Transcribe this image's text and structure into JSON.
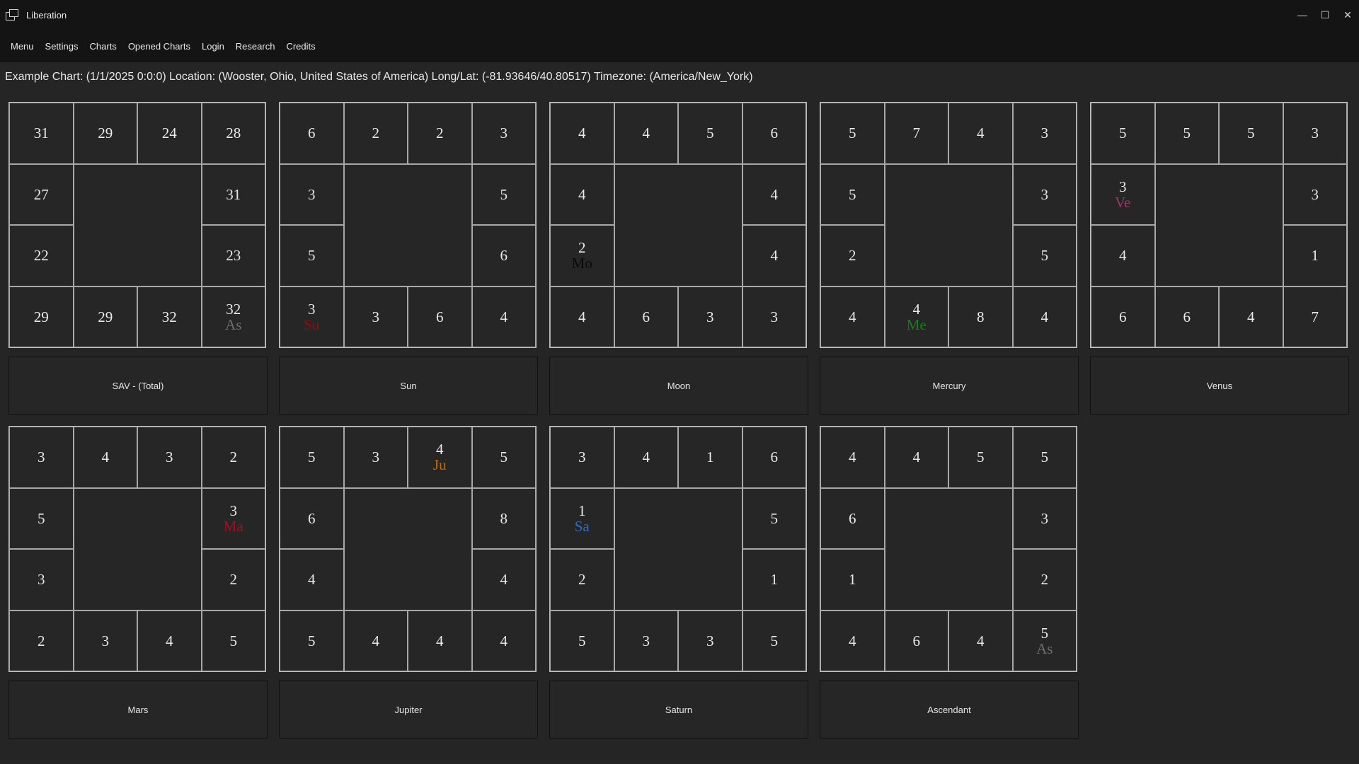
{
  "window": {
    "title": "Liberation",
    "minimize": "—",
    "maximize": "☐",
    "close": "✕"
  },
  "menu": [
    "Menu",
    "Settings",
    "Charts",
    "Opened Charts",
    "Login",
    "Research",
    "Credits"
  ],
  "info": "Example Chart: (1/1/2025 0:0:0) Location: (Wooster, Ohio, United States of America) Long/Lat: (-81.93646/40.80517) Timezone: (America/New_York)",
  "charts": [
    {
      "label": "SAV - (Total)",
      "cells": [
        "31",
        "29",
        "24",
        "28",
        "27",
        "31",
        "22",
        "23",
        "29",
        "29",
        "32",
        "32"
      ],
      "marker": {
        "cell": 11,
        "text": "As",
        "color": "#6e6e6e"
      }
    },
    {
      "label": "Sun",
      "cells": [
        "6",
        "2",
        "2",
        "3",
        "3",
        "5",
        "5",
        "6",
        "3",
        "3",
        "6",
        "4"
      ],
      "marker": {
        "cell": 8,
        "text": "Su",
        "color": "#8b1010"
      }
    },
    {
      "label": "Moon",
      "cells": [
        "4",
        "4",
        "5",
        "6",
        "4",
        "4",
        "2",
        "4",
        "4",
        "6",
        "3",
        "3"
      ],
      "marker": {
        "cell": 6,
        "text": "Mo",
        "color": "#0a0a0a"
      }
    },
    {
      "label": "Mercury",
      "cells": [
        "5",
        "7",
        "4",
        "3",
        "5",
        "3",
        "2",
        "5",
        "4",
        "4",
        "8",
        "4"
      ],
      "marker": {
        "cell": 9,
        "text": "Me",
        "color": "#1e7a1e"
      }
    },
    {
      "label": "Venus",
      "cells": [
        "5",
        "5",
        "5",
        "3",
        "3",
        "3",
        "4",
        "1",
        "6",
        "6",
        "4",
        "7"
      ],
      "marker": {
        "cell": 4,
        "text": "Ve",
        "color": "#a0336e"
      }
    },
    {
      "label": "Mars",
      "cells": [
        "3",
        "4",
        "3",
        "2",
        "5",
        "3",
        "3",
        "2",
        "2",
        "3",
        "4",
        "5"
      ],
      "marker": {
        "cell": 5,
        "text": "Ma",
        "color": "#a01020"
      }
    },
    {
      "label": "Jupiter",
      "cells": [
        "5",
        "3",
        "4",
        "5",
        "6",
        "8",
        "4",
        "4",
        "5",
        "4",
        "4",
        "4"
      ],
      "marker": {
        "cell": 2,
        "text": "Ju",
        "color": "#c06a12"
      }
    },
    {
      "label": "Saturn",
      "cells": [
        "3",
        "4",
        "1",
        "6",
        "1",
        "5",
        "2",
        "1",
        "5",
        "3",
        "3",
        "5"
      ],
      "marker": {
        "cell": 4,
        "text": "Sa",
        "color": "#2a6fc8"
      }
    },
    {
      "label": "Ascendant",
      "cells": [
        "4",
        "4",
        "5",
        "5",
        "6",
        "3",
        "1",
        "2",
        "4",
        "6",
        "4",
        "5"
      ],
      "marker": {
        "cell": 11,
        "text": "As",
        "color": "#6e6e6e"
      }
    }
  ]
}
